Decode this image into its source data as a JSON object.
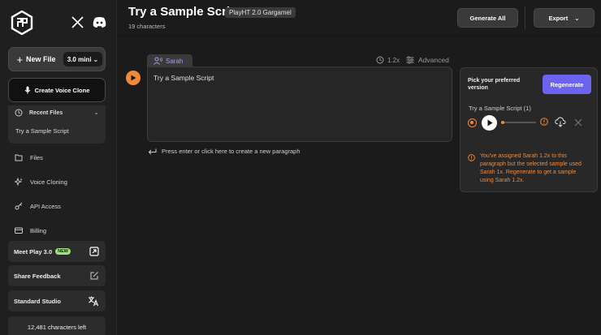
{
  "sidebar": {
    "new_file_label": "New File",
    "model_label": "3.0 mini",
    "create_voice_clone_label": "Create Voice Clone",
    "recent_files_label": "Recent Files",
    "recent_files": [
      "Try a Sample Script"
    ],
    "nav": [
      {
        "label": "Files",
        "icon": "files-icon"
      },
      {
        "label": "Voice Cloning",
        "icon": "sparkle-icon"
      },
      {
        "label": "API Access",
        "icon": "key-icon"
      },
      {
        "label": "Billing",
        "icon": "credit-card-icon"
      }
    ],
    "meet_play_label": "Meet Play 3.0",
    "new_badge": "NEW",
    "share_feedback_label": "Share Feedback",
    "standard_studio_label": "Standard Studio",
    "characters_left": "12,481 characters left"
  },
  "header": {
    "title": "Try a Sample Script",
    "model_tag": "PlayHT 2.0 Gargamel",
    "char_count": "19 characters",
    "generate_all_label": "Generate All",
    "export_label": "Export"
  },
  "editor": {
    "voice_name": "Sarah",
    "speed": "1.2x",
    "advanced_label": "Advanced",
    "paragraph_text": "Try a Sample Script",
    "enter_hint": "Press enter or click here to create a new paragraph"
  },
  "panel": {
    "pick_label": "Pick your preferred version",
    "regenerate_label": "Regenerate",
    "sample_title": "Try a Sample Script (1)",
    "warning": "You've assigned Sarah 1.2x to this paragraph but the selected sample used Sarah 1x. Regenerate to get a sample using Sarah 1.2x."
  },
  "colors": {
    "accent_orange": "#f08a3a",
    "accent_purple": "#6c63ef",
    "voice_chip_text": "#a29bf2",
    "new_badge_bg": "#9be37a"
  }
}
